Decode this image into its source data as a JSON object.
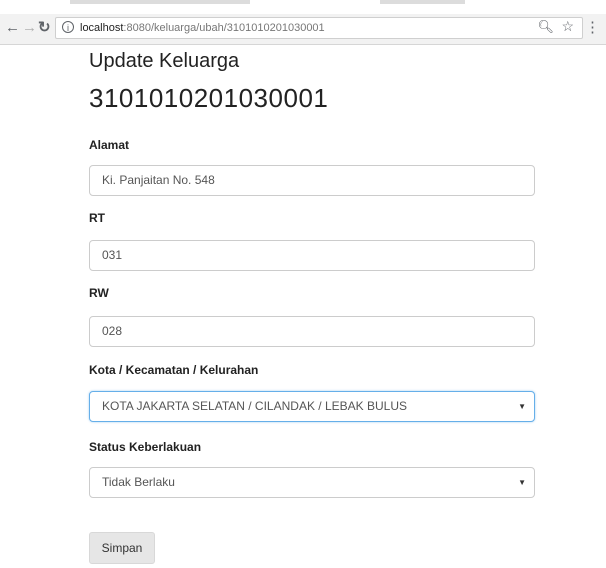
{
  "browser": {
    "url_host": "localhost",
    "url_rest": ":8080/keluarga/ubah/3101010201030001",
    "icons": {
      "back": "arrow-left-icon",
      "forward": "arrow-right-icon",
      "reload": "reload-icon",
      "info": "info-icon",
      "zoom": "zoom-icon",
      "star": "star-icon",
      "menu": "menu-dots-icon"
    }
  },
  "page": {
    "title": "Update Keluarga",
    "code": "3101010201030001"
  },
  "form": {
    "alamat": {
      "label": "Alamat",
      "value": "Ki. Panjaitan No. 548"
    },
    "rt": {
      "label": "RT",
      "value": "031"
    },
    "rw": {
      "label": "RW",
      "value": "028"
    },
    "kota": {
      "label": "Kota / Kecamatan / Kelurahan",
      "value": "KOTA JAKARTA SELATAN / CILANDAK / LEBAK BULUS"
    },
    "status": {
      "label": "Status Keberlakuan",
      "value": "Tidak Berlaku"
    },
    "submit_label": "Simpan"
  },
  "colors": {
    "focus_border": "#66afe9",
    "button_bg": "#e6e6e6"
  }
}
